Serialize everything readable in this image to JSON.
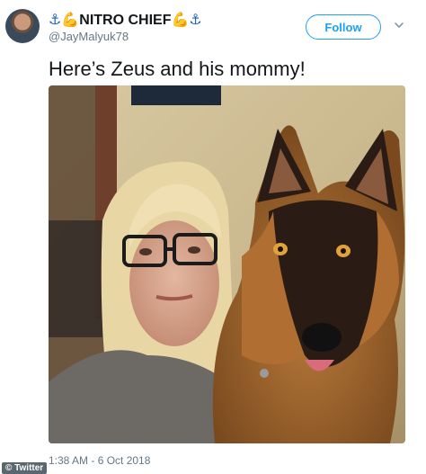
{
  "tweet": {
    "display_name_text": "NITRO CHIEF",
    "handle": "@JayMalyuk78",
    "follow_label": "Follow",
    "text": "Here’s Zeus and his mommy!",
    "timestamp": "1:38 AM - 6 Oct 2018",
    "anchor_glyph": "⚓",
    "arm_left_glyph": "💪",
    "arm_right_glyph": "💪"
  },
  "watermark": {
    "label": "© Twitter"
  },
  "icons": {
    "avatar": "user-avatar",
    "menu": "chevron-down-icon",
    "emoji": [
      "anchor-icon",
      "flexed-biceps-icon"
    ]
  },
  "colors": {
    "accent": "#1da1f2",
    "text": "#14171a",
    "muted": "#657786",
    "anchor": "#1f63b8"
  }
}
